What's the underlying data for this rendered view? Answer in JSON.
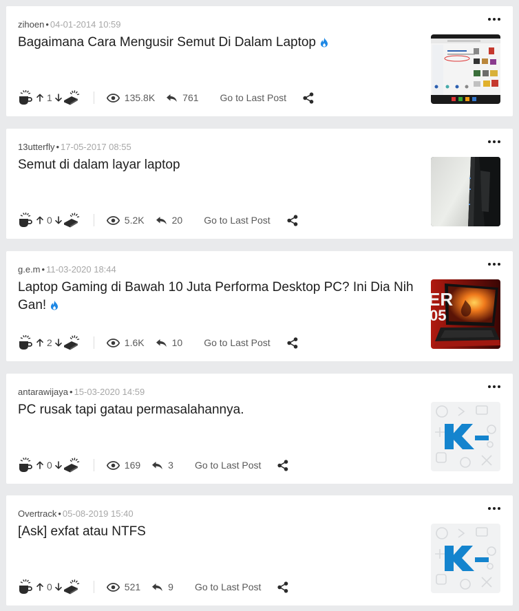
{
  "threads": [
    {
      "author": "zihoen",
      "date": "04-01-2014 10:59",
      "title": "Bagaimana Cara Mengusir Semut Di Dalam Laptop",
      "hot": true,
      "votes": "1",
      "views": "135.8K",
      "replies": "761",
      "last_post_label": "Go to Last Post",
      "thumbnail": "screenshot-store"
    },
    {
      "author": "13utterfly",
      "date": "17-05-2017 08:55",
      "title": "Semut di dalam layar laptop",
      "hot": false,
      "votes": "0",
      "views": "5.2K",
      "replies": "20",
      "last_post_label": "Go to Last Post",
      "thumbnail": "laptop-screen-photo"
    },
    {
      "author": "g.e.m",
      "date": "11-03-2020 18:44",
      "title": "Laptop Gaming di Bawah 10 Juta Performa Desktop PC? Ini Dia Nih Gan!",
      "hot": true,
      "votes": "2",
      "views": "1.6K",
      "replies": "10",
      "last_post_label": "Go to Last Post",
      "thumbnail": "gaming-laptop"
    },
    {
      "author": "antarawijaya",
      "date": "15-03-2020 14:59",
      "title": "PC rusak tapi gatau permasalahannya.",
      "hot": false,
      "votes": "0",
      "views": "169",
      "replies": "3",
      "last_post_label": "Go to Last Post",
      "thumbnail": "kaskus-logo"
    },
    {
      "author": "Overtrack",
      "date": "05-08-2019 15:40",
      "title": "[Ask] exfat atau NTFS",
      "hot": false,
      "votes": "0",
      "views": "521",
      "replies": "9",
      "last_post_label": "Go to Last Post",
      "thumbnail": "kaskus-logo"
    }
  ],
  "icons": {
    "cendol": "cendol-cup-icon",
    "upvote": "arrow-up-icon",
    "downvote": "arrow-down-icon",
    "bata": "brick-icon",
    "views": "eye-icon",
    "replies": "reply-icon",
    "share": "share-icon",
    "hot": "fire-icon",
    "more": "more-dots-icon"
  },
  "colors": {
    "background": "#e9eaec",
    "card": "#ffffff",
    "hot": "#1e88e5",
    "kaskus_blue": "#1484ce",
    "text_muted": "#a7a7a7"
  }
}
